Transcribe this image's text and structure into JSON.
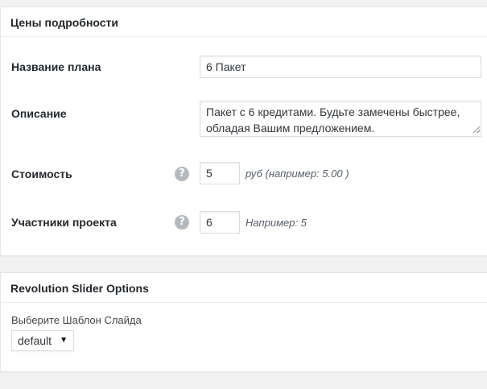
{
  "price_details": {
    "title": "Цены подробности",
    "plan_name": {
      "label": "Название плана",
      "value": "6 Пакет"
    },
    "description": {
      "label": "Описание",
      "value": "Пакет с 6 кредитами. Будьте замечены быстрее, обладая Вашим предложением."
    },
    "cost": {
      "label": "Стоимость",
      "value": "5",
      "hint": "руб (например: 5.00 )"
    },
    "project_members": {
      "label": "Участники проекта",
      "value": "6",
      "hint": "Например: 5"
    }
  },
  "revolution_slider": {
    "title": "Revolution Slider Options",
    "template_label": "Выберите Шаблон Слайда",
    "template_selected": "default"
  },
  "icons": {
    "help": "help-icon",
    "select_caret": "caret-down-icon"
  },
  "colors": {
    "background": "#f1f1f1",
    "panel": "#ffffff",
    "help_icon": "#b4b9be"
  }
}
